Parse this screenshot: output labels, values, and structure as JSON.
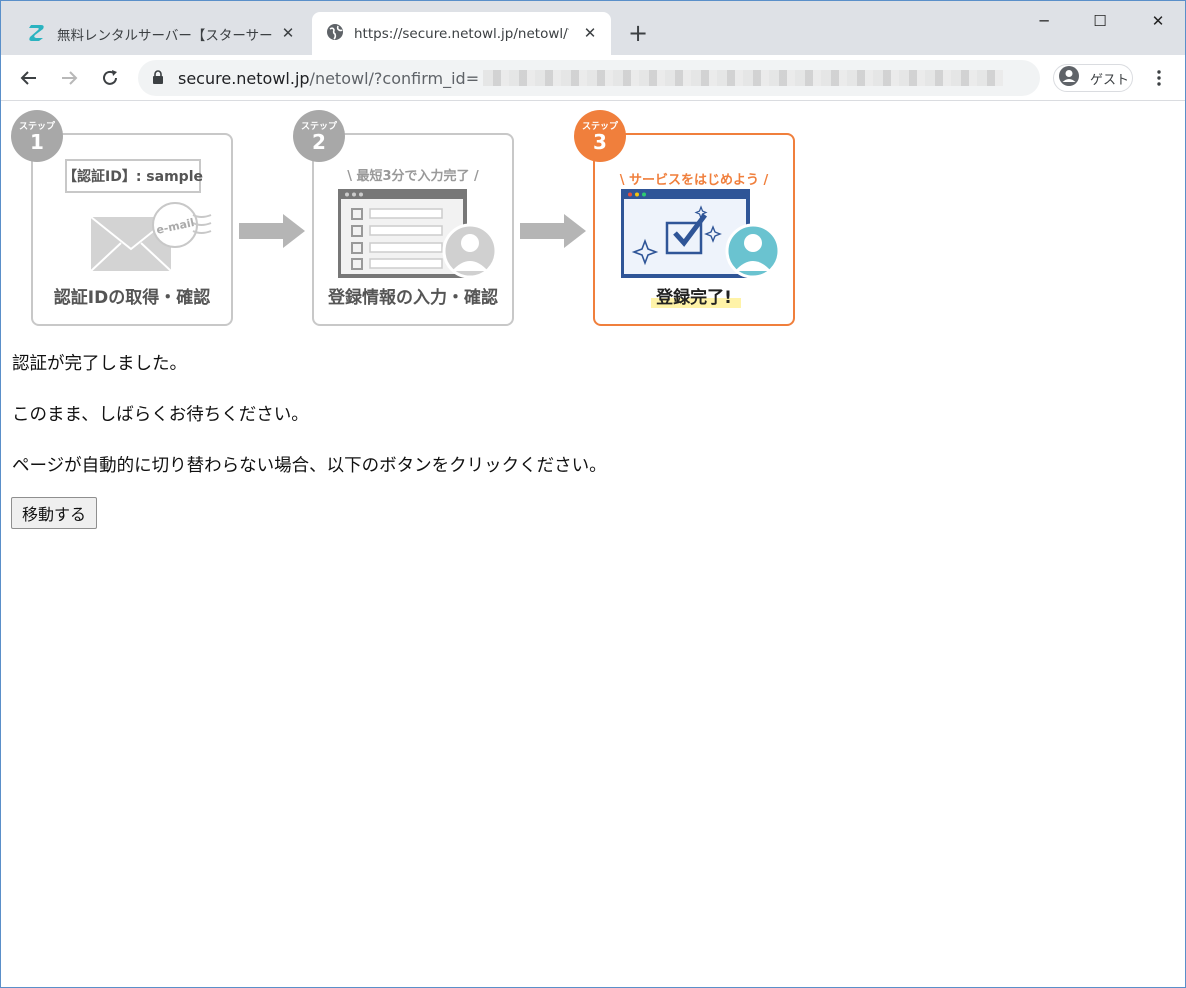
{
  "browser": {
    "tabs": [
      {
        "title": "無料レンタルサーバー【スターサーバーフリー】",
        "favicon": "star-server-favicon",
        "active": false
      },
      {
        "title": "https://secure.netowl.jp/netowl/?confirm_id=",
        "favicon": "globe-icon",
        "active": true
      }
    ],
    "new_tab_label": "+",
    "window_controls": {
      "minimize": "─",
      "maximize": "☐",
      "close": "✕"
    },
    "url": {
      "host": "secure.netowl.jp",
      "path": "/netowl/?confirm_id="
    },
    "profile_label": "ゲスト"
  },
  "steps": [
    {
      "badge_caption": "ステップ",
      "number": "1",
      "label": "認証IDの取得・確認",
      "id_box": "【認証ID】: sample",
      "stamp": "e-mail",
      "active": false
    },
    {
      "badge_caption": "ステップ",
      "number": "2",
      "label": "登録情報の入力・確認",
      "caption": "最短3分で入力完了",
      "active": false
    },
    {
      "badge_caption": "ステップ",
      "number": "3",
      "label": "登録完了!",
      "caption": "サービスをはじめよう",
      "active": true
    }
  ],
  "messages": {
    "line1": "認証が完了しました。",
    "line2": "このまま、しばらくお待ちください。",
    "line3": "ページが自動的に切り替わらない場合、以下のボタンをクリックください。"
  },
  "button_label": "移動する",
  "colors": {
    "accent": "#f07f3c",
    "inactive_gray": "#a8a8a8",
    "monitor_blue": "#2f5597"
  }
}
